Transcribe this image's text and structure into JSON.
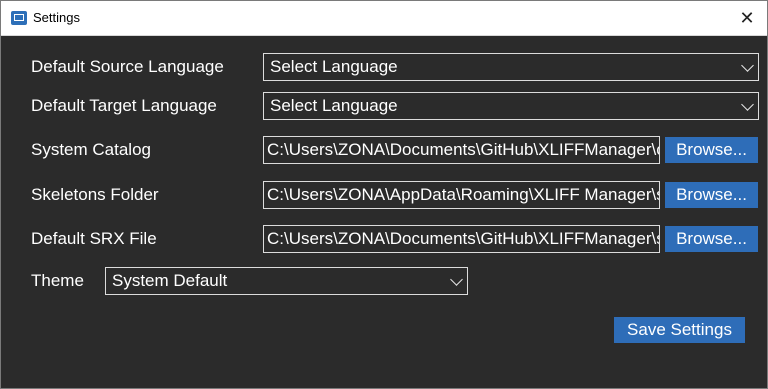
{
  "window": {
    "title": "Settings",
    "close_glyph": "✕"
  },
  "labels": {
    "source_language": "Default Source Language",
    "target_language": "Default Target Language",
    "system_catalog": "System Catalog",
    "skeletons_folder": "Skeletons Folder",
    "srx_file": "Default SRX File",
    "theme": "Theme"
  },
  "selects": {
    "source_language": "Select Language",
    "target_language": "Select Language",
    "theme": "System Default"
  },
  "fields": {
    "system_catalog": "C:\\Users\\ZONA\\Documents\\GitHub\\XLIFFManager\\catalog\\catalog.xml",
    "skeletons_folder": "C:\\Users\\ZONA\\AppData\\Roaming\\XLIFF Manager\\skeletons",
    "srx_file": "C:\\Users\\ZONA\\Documents\\GitHub\\XLIFFManager\\srx\\default.srx"
  },
  "buttons": {
    "browse": "Browse...",
    "save": "Save Settings"
  },
  "icons": {
    "app": "app-window-icon",
    "chevron": "chevron-down-icon",
    "close": "close-icon"
  },
  "colors": {
    "background": "#2b2b2b",
    "accent": "#2e6db8",
    "border": "#dcdcdc"
  }
}
